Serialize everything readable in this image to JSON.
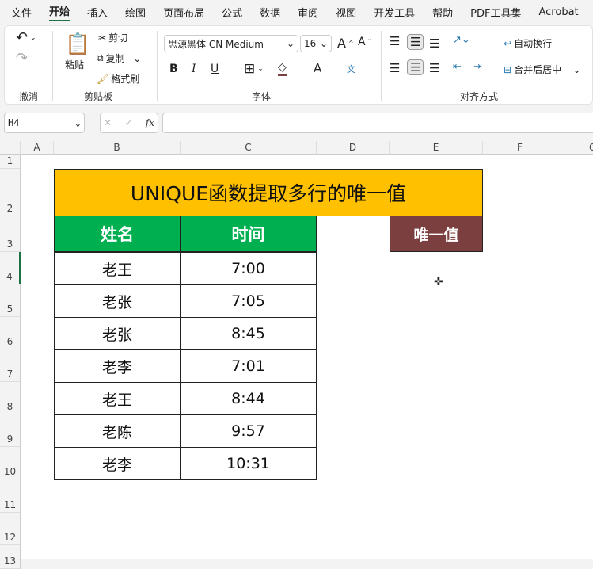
{
  "menu": [
    "文件",
    "开始",
    "插入",
    "绘图",
    "页面布局",
    "公式",
    "数据",
    "审阅",
    "视图",
    "开发工具",
    "帮助",
    "PDF工具集",
    "Acrobat"
  ],
  "ribbon": {
    "undo_group": "撤消",
    "clipboard": {
      "paste": "粘贴",
      "cut": "剪切",
      "copy": "复制",
      "format_painter": "格式刷",
      "label": "剪贴板"
    },
    "font": {
      "name": "思源黑体 CN Medium",
      "size": "16",
      "bold": "B",
      "italic": "I",
      "underline": "U",
      "font_color": "A",
      "phonetic": "文",
      "label": "字体"
    },
    "alignment": {
      "wrap": "自动换行",
      "merge": "合并后居中",
      "label": "对齐方式"
    }
  },
  "formula_bar": {
    "name_box": "H4",
    "fx": "fx",
    "value": ""
  },
  "columns": [
    "A",
    "B",
    "C",
    "D",
    "E",
    "F",
    "G"
  ],
  "rows": [
    "1",
    "2",
    "3",
    "4",
    "5",
    "6",
    "7",
    "8",
    "9",
    "10",
    "11",
    "12",
    "13"
  ],
  "sheet": {
    "title": "UNIQUE函数提取多行的唯一值",
    "headers": [
      "姓名",
      "时间"
    ],
    "data": [
      [
        "老王",
        "7:00"
      ],
      [
        "老张",
        "7:05"
      ],
      [
        "老张",
        "8:45"
      ],
      [
        "老李",
        "7:01"
      ],
      [
        "老王",
        "8:44"
      ],
      [
        "老陈",
        "9:57"
      ],
      [
        "老李",
        "10:31"
      ]
    ],
    "unique_header": "唯一值"
  },
  "colors": {
    "title_bg": "#ffc000",
    "header_bg": "#00b050",
    "unique_bg": "#7b3f3f",
    "accent": "#1e7145"
  }
}
